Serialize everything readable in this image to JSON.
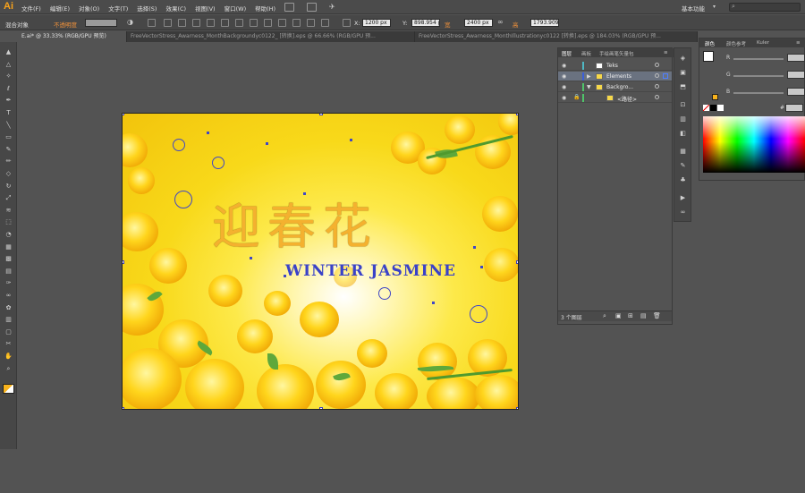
{
  "app": {
    "logo": "Ai"
  },
  "menu": [
    "文件(F)",
    "编辑(E)",
    "对象(O)",
    "文字(T)",
    "选择(S)",
    "效果(C)",
    "视图(V)",
    "窗口(W)",
    "帮助(H)"
  ],
  "workspace": {
    "label": "基本功能",
    "arrow": "▾"
  },
  "control_bar": {
    "selection_label": "混合对象",
    "opacity_label": "不透明度",
    "x_value": "1200 px",
    "y_value": "898.954 p",
    "w_label": "宽",
    "w_value": "2400 px",
    "h_label": "高",
    "h_value": "1793.909"
  },
  "tabs": [
    {
      "label": "E.ai* @ 33.33% (RGB/GPU 预览)",
      "active": true
    },
    {
      "label": "FreeVectorStress_Awarness_MonthBackgroundyc0122_ [转换].eps @ 66.66% (RGB/GPU 预...",
      "active": false
    },
    {
      "label": "FreeVectorStress_Awarness_MonthIllustrationyc0122 [转换].eps @ 184.03% (RGB/GPU 预...",
      "active": false
    }
  ],
  "tools": [
    "arrow-select-icon",
    "direct-select-icon",
    "magic-wand-icon",
    "lasso-icon",
    "pen-icon",
    "type-icon",
    "line-icon",
    "rectangle-icon",
    "paintbrush-icon",
    "pencil-icon",
    "eraser-icon",
    "rotate-icon",
    "scale-icon",
    "width-icon",
    "free-transform-icon",
    "shape-builder-icon",
    "perspective-icon",
    "mesh-icon",
    "gradient-icon",
    "eyedropper-icon",
    "blend-icon",
    "symbol-sprayer-icon",
    "graph-icon",
    "artboard-icon",
    "slice-icon",
    "hand-icon",
    "zoom-icon"
  ],
  "tool_glyphs": [
    "▲",
    "△",
    "✧",
    "ℓ",
    "✒",
    "T",
    "╲",
    "▭",
    "✎",
    "✏",
    "◇",
    "↻",
    "⤢",
    "≋",
    "⬚",
    "◔",
    "▦",
    "▩",
    "▤",
    "✑",
    "∞",
    "✿",
    "▥",
    "▢",
    "✂",
    "✋",
    "⌕"
  ],
  "artwork": {
    "title_cn": "迎春花",
    "title_en": "WINTER JASMINE"
  },
  "layers_panel": {
    "tabs": [
      "图层",
      "画板",
      "手绘画笔矢量包"
    ],
    "layers": [
      {
        "name": "Teks",
        "color": "#4fb8c4",
        "selected": false,
        "locked": false,
        "expanded": false
      },
      {
        "name": "Elements",
        "color": "#3c5fd8",
        "selected": true,
        "locked": false,
        "expanded": false
      },
      {
        "name": "Backgro...",
        "color": "#4fc46a",
        "selected": false,
        "locked": false,
        "expanded": true
      },
      {
        "name": "<路径>",
        "color": "#4fc46a",
        "selected": false,
        "locked": true,
        "expanded": false,
        "sublayer": true
      }
    ],
    "footer_count": "3 个图层"
  },
  "color_panel": {
    "tabs": [
      "颜色",
      "颜色参考",
      "Kuler"
    ],
    "channels": [
      "R",
      "G",
      "B"
    ],
    "hex_label": "#",
    "fill_color": "#f7b21c",
    "stroke_color": "#ffffff"
  },
  "colors": {
    "accent_orange": "#f0913a",
    "selection_blue": "#4047c6",
    "flower_yellow": "#ffd51c"
  }
}
